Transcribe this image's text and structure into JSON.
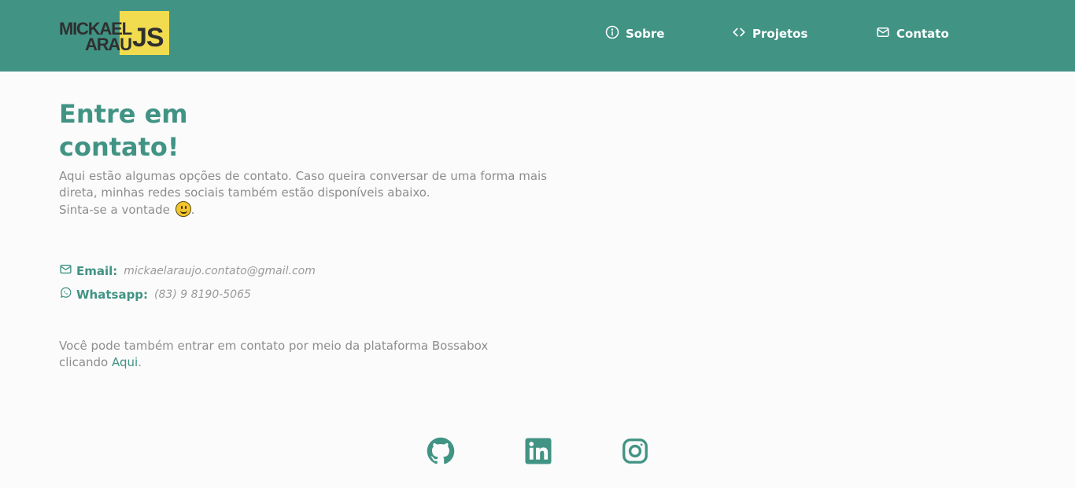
{
  "brand": {
    "logo_line1": "MICKAEL",
    "logo_line2": "ARAU",
    "logo_js": "JS",
    "colors": {
      "primary": "#419384",
      "logo_accent": "#f0dc4e",
      "logo_text": "#2f2f2f"
    }
  },
  "nav": {
    "items": [
      {
        "label": "Sobre",
        "icon": "info-icon"
      },
      {
        "label": "Projetos",
        "icon": "code-icon"
      },
      {
        "label": "Contato",
        "icon": "mail-icon"
      }
    ]
  },
  "main": {
    "title_line1": "Entre em",
    "title_line2": "contato!",
    "intro_line1": "Aqui estão algumas opções de contato. Caso queira conversar de uma forma mais",
    "intro_line2": "direta, minhas redes sociais também estão disponíveis abaixo.",
    "intro_line3": "Sinta-se a vontade",
    "intro_line3_end": ".",
    "emoji": "grinning-face-icon",
    "contacts": {
      "email": {
        "label": "Email:",
        "value": "mickaelaraujo.contato@gmail.com",
        "icon": "mail-icon"
      },
      "whatsapp": {
        "label": "Whatsapp:",
        "value": "(83) 9 8190-5065",
        "icon": "whatsapp-icon"
      }
    },
    "bossabox": {
      "line1": "Você pode também entrar em contato por meio da plataforma Bossabox",
      "line2_prefix": "clicando ",
      "link_text": "Aqui",
      "line2_suffix": "."
    }
  },
  "social": [
    {
      "name": "github",
      "icon": "github-icon"
    },
    {
      "name": "linkedin",
      "icon": "linkedin-icon"
    },
    {
      "name": "instagram",
      "icon": "instagram-icon"
    }
  ]
}
